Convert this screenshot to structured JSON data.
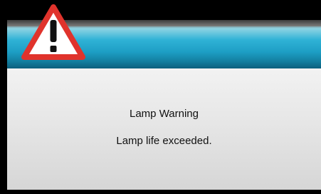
{
  "dialog": {
    "icon": "warning-triangle-icon",
    "title": "Lamp Warning",
    "message": "Lamp life exceeded."
  },
  "colors": {
    "header_accent": "#2fb2d6",
    "panel": "#e6e6e6",
    "warning_red": "#e0332c",
    "warning_bg": "#ffffff",
    "text": "#111111"
  }
}
